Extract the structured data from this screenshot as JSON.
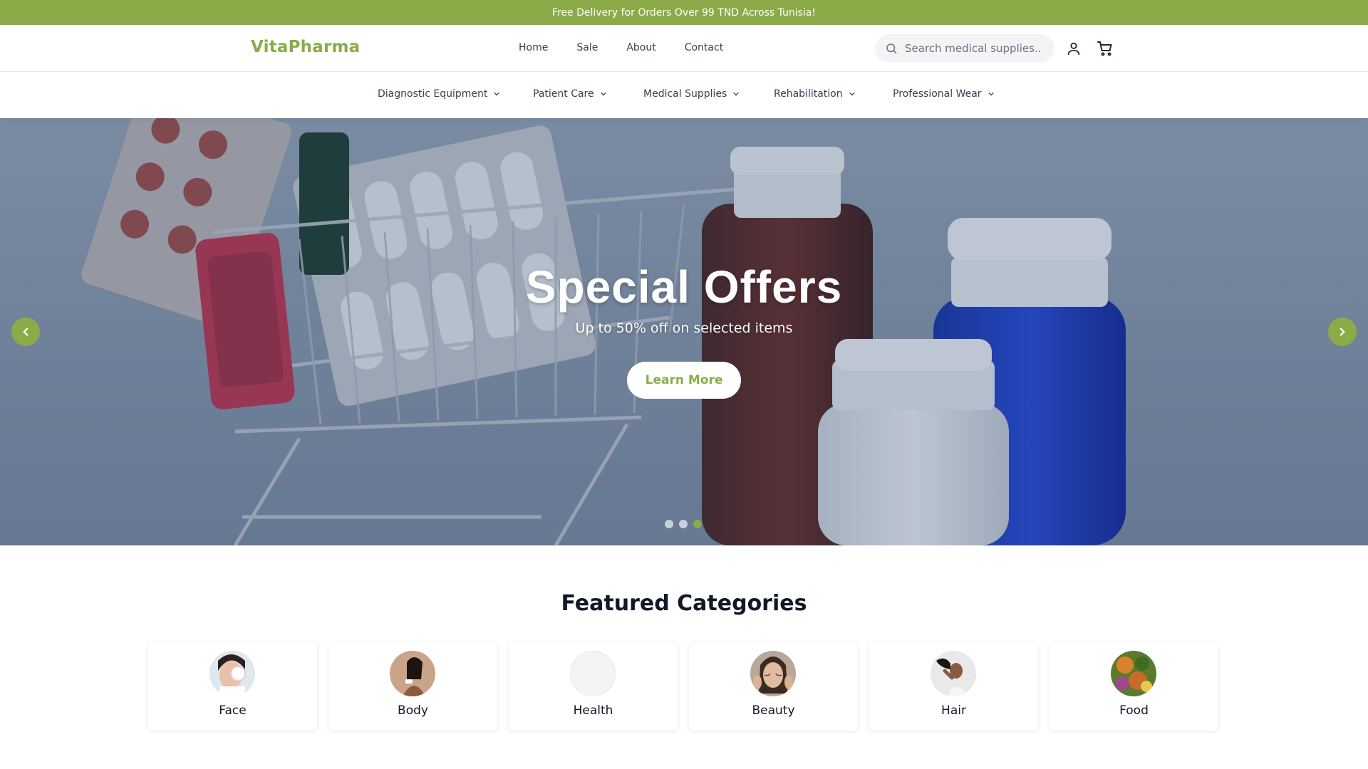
{
  "promo": {
    "text": "Free Delivery for Orders Over 99 TND Across Tunisia!"
  },
  "brand": {
    "name": "VitaPharma",
    "accent_color": "#8aab48"
  },
  "top_nav": {
    "items": [
      {
        "label": "Home"
      },
      {
        "label": "Sale"
      },
      {
        "label": "About"
      },
      {
        "label": "Contact"
      }
    ]
  },
  "search": {
    "placeholder": "Search medical supplies...",
    "icon": "search-icon"
  },
  "header_icons": {
    "account": "user-icon",
    "cart": "cart-icon"
  },
  "category_nav": {
    "items": [
      {
        "label": "Diagnostic Equipment"
      },
      {
        "label": "Patient Care"
      },
      {
        "label": "Medical Supplies"
      },
      {
        "label": "Rehabilitation"
      },
      {
        "label": "Professional Wear"
      }
    ]
  },
  "hero": {
    "title": "Special Offers",
    "subtitle": "Up to 50% off on selected items",
    "button_label": "Learn More",
    "slide_count": 3,
    "active_slide": 3
  },
  "featured": {
    "title": "Featured Categories",
    "categories": [
      {
        "label": "Face"
      },
      {
        "label": "Body"
      },
      {
        "label": "Health"
      },
      {
        "label": "Beauty"
      },
      {
        "label": "Hair"
      },
      {
        "label": "Food"
      }
    ]
  }
}
